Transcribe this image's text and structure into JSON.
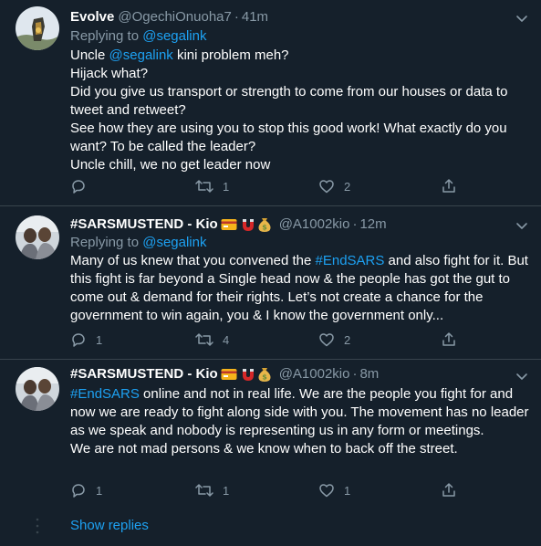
{
  "tweets": [
    {
      "name": "Evolve",
      "handle": "@OgechiOnuoha7",
      "dot": "·",
      "time": "41m",
      "replying_label": "Replying to",
      "replying_handle": "@segalink",
      "body_parts": {
        "l1_pre": "Uncle ",
        "l1_link": "@segalink",
        "l1_post": " kini problem meh?",
        "l2": "Hijack what?",
        "l3": "Did you give us transport or strength to come from our houses or data to tweet and retweet?",
        "l4": "See how they are using you to stop this good work! What exactly do you want? To be called the leader?",
        "l5": "Uncle chill, we no get leader now"
      },
      "reply_count": "",
      "retweet_count": "1",
      "like_count": "2"
    },
    {
      "name": "#SARSMUSTEND - Kio",
      "handle": "@A1002kio",
      "dot": "·",
      "time": "12m",
      "replying_label": "Replying to",
      "replying_handle": "@segalink",
      "body_parts": {
        "pre": "Many of us knew that you convened the ",
        "link": "#EndSARS",
        "post": " and also fight for it. But this fight is far beyond a Single head now & the people has got the gut to come out & demand for their rights. Let’s not create a chance for the government to win again, you & I know the government only..."
      },
      "reply_count": "1",
      "retweet_count": "4",
      "like_count": "2"
    },
    {
      "name": "#SARSMUSTEND - Kio",
      "handle": "@A1002kio",
      "dot": "·",
      "time": "8m",
      "body_parts": {
        "link": "#EndSARS",
        "post": " online and not in real life. We are the people you fight for and now we are ready to fight along side with you. The movement has no leader as we speak and nobody is representing us in any form or meetings.",
        "l2": "We are not mad persons & we know when to back off the street."
      },
      "reply_count": "1",
      "retweet_count": "1",
      "like_count": "1"
    }
  ],
  "show_replies": "Show replies",
  "colors": {
    "background": "#15202b",
    "divider": "#38444d",
    "link": "#1da1f2",
    "secondary": "#8899a6",
    "text": "#ffffff"
  },
  "icons": [
    "chevron-down-icon",
    "reply-icon",
    "retweet-icon",
    "like-icon",
    "share-icon",
    "credit-card-emoji",
    "magnet-emoji",
    "money-bag-emoji"
  ]
}
